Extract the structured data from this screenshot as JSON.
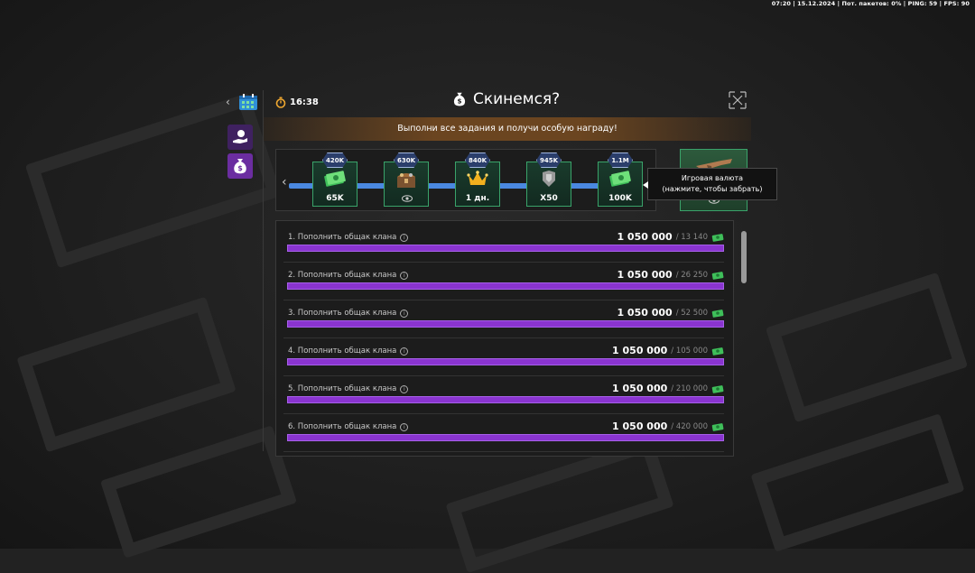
{
  "status_bar": "07:20 | 15.12.2024 | Пот. пакетов: 0% | PING: 59 | FPS: 90",
  "timer": "16:38",
  "title": "Скинемся?",
  "banner": "Выполни все задания и получи особую награду!",
  "milestones": [
    {
      "badge": "420K",
      "label": "65K",
      "icon": "cash-icon"
    },
    {
      "badge": "630K",
      "label": "",
      "icon": "chest-icon"
    },
    {
      "badge": "840K",
      "label": "1 дн.",
      "icon": "crown-icon"
    },
    {
      "badge": "945K",
      "label": "X50",
      "icon": "armor-icon"
    },
    {
      "badge": "1.1M",
      "label": "100K",
      "icon": "cash-icon"
    }
  ],
  "tooltip": {
    "line1": "Игровая валюта",
    "line2": "(нажмите, чтобы забрать)"
  },
  "tasks": [
    {
      "name": "1. Пополнить общак клана",
      "target": "1 050 000",
      "current": "/ 13 140"
    },
    {
      "name": "2. Пополнить общак клана",
      "target": "1 050 000",
      "current": "/ 26 250"
    },
    {
      "name": "3. Пополнить общак клана",
      "target": "1 050 000",
      "current": "/ 52 500"
    },
    {
      "name": "4. Пополнить общак клана",
      "target": "1 050 000",
      "current": "/ 105 000"
    },
    {
      "name": "5. Пополнить общак клана",
      "target": "1 050 000",
      "current": "/ 210 000"
    },
    {
      "name": "6. Пополнить общак клана",
      "target": "1 050 000",
      "current": "/ 420 000"
    }
  ],
  "colors": {
    "accent_purple": "#8a34d0",
    "track_blue": "#4a88e0",
    "node_green": "#3aa36a"
  }
}
